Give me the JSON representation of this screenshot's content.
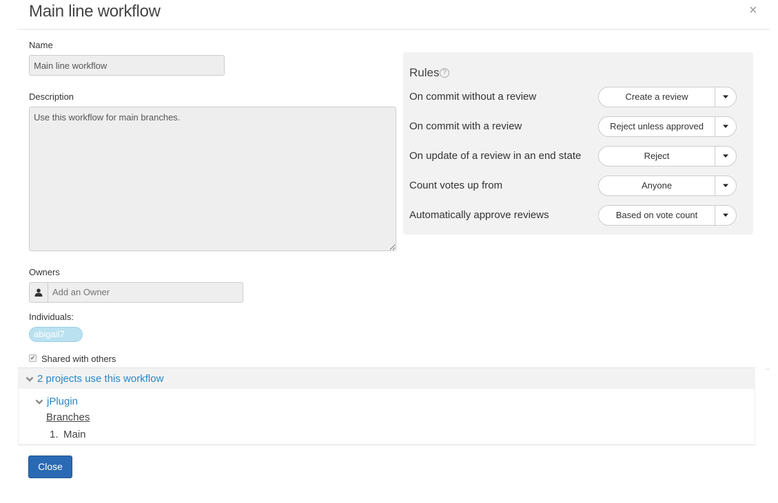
{
  "modal": {
    "title": "Main line workflow",
    "close_glyph": "×"
  },
  "form": {
    "name_label": "Name",
    "name_value": "Main line workflow",
    "description_label": "Description",
    "description_value": "Use this workflow for main branches.",
    "owners_label": "Owners",
    "owner_placeholder": "Add an Owner",
    "owner_icon": "user-icon",
    "individuals_label": "Individuals:",
    "individuals": [
      "abigail7"
    ],
    "shared_label": "Shared with others",
    "shared_checked": true
  },
  "rules": {
    "title": "Rules",
    "help_glyph": "?",
    "items": [
      {
        "label": "On commit without a review",
        "value": "Create a review"
      },
      {
        "label": "On commit with a review",
        "value": "Reject unless approved"
      },
      {
        "label": "On update of a review in an end state",
        "value": "Reject"
      },
      {
        "label": "Count votes up from",
        "value": "Anyone"
      },
      {
        "label": "Automatically approve reviews",
        "value": "Based on vote count"
      }
    ]
  },
  "projects": {
    "summary": "2 projects use this workflow",
    "items": [
      {
        "name": "jPlugin",
        "branches_label": "Branches",
        "branch_number": "1.",
        "branch_name": "Main"
      }
    ]
  },
  "footer": {
    "close_label": "Close"
  },
  "colors": {
    "link": "#2a86c4",
    "primary_button": "#2a6ab4",
    "tag_bg": "#b9e1f0"
  }
}
